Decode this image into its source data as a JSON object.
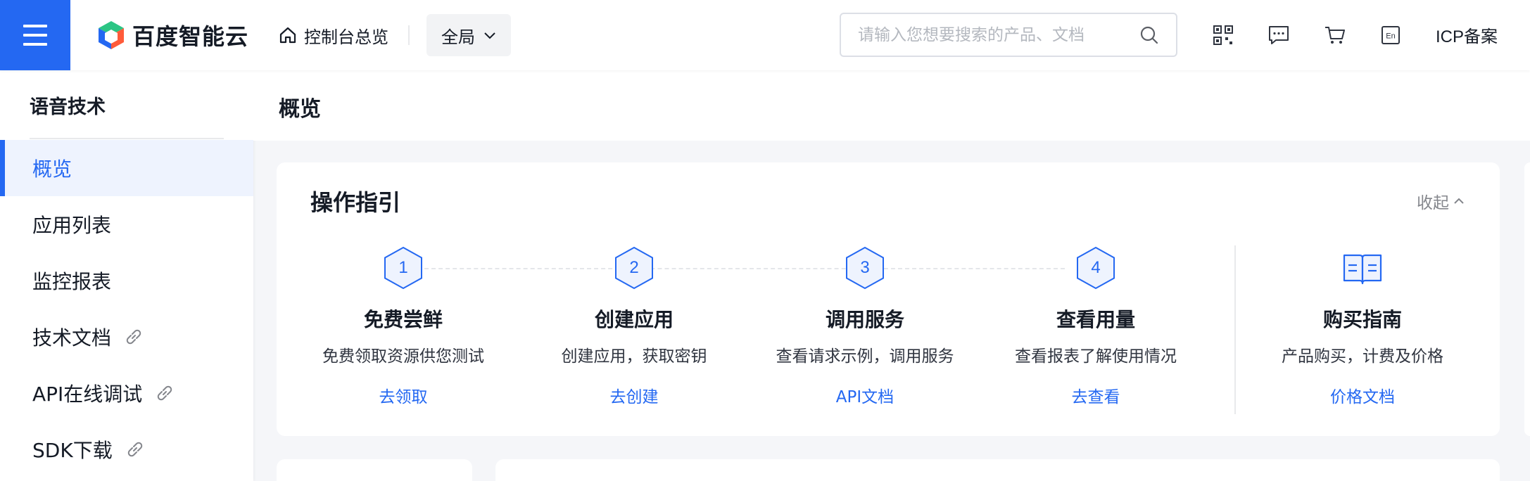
{
  "topbar": {
    "logo_text": "百度智能云",
    "home_label": "控制台总览",
    "region_label": "全局",
    "search_placeholder": "请输入您想要搜索的产品、文档",
    "icons": [
      "qrcode-icon",
      "message-icon",
      "cart-icon",
      "language-en-icon"
    ],
    "lang_label": "En",
    "icp_label": "ICP备案"
  },
  "sidebar": {
    "title": "语音技术",
    "items": [
      {
        "label": "概览",
        "active": true,
        "external": false
      },
      {
        "label": "应用列表",
        "active": false,
        "external": false
      },
      {
        "label": "监控报表",
        "active": false,
        "external": false
      },
      {
        "label": "技术文档",
        "active": false,
        "external": true
      },
      {
        "label": "API在线调试",
        "active": false,
        "external": true
      },
      {
        "label": "SDK下载",
        "active": false,
        "external": true
      }
    ]
  },
  "main": {
    "page_title": "概览",
    "guide": {
      "title": "操作指引",
      "collapse_label": "收起",
      "steps": [
        {
          "num": "1",
          "title": "免费尝鲜",
          "desc": "免费领取资源供您测试",
          "link": "去领取"
        },
        {
          "num": "2",
          "title": "创建应用",
          "desc": "创建应用，获取密钥",
          "link": "去创建"
        },
        {
          "num": "3",
          "title": "调用服务",
          "desc": "查看请求示例，调用服务",
          "link": "API文档"
        },
        {
          "num": "4",
          "title": "查看用量",
          "desc": "查看报表了解使用情况",
          "link": "去查看"
        }
      ],
      "purchase": {
        "title": "购买指南",
        "desc": "产品购买，计费及价格",
        "link": "价格文档"
      }
    }
  },
  "colors": {
    "accent": "#2468f2",
    "text": "#151b26",
    "muted": "#84868c",
    "page_bg": "#f5f6f9"
  }
}
